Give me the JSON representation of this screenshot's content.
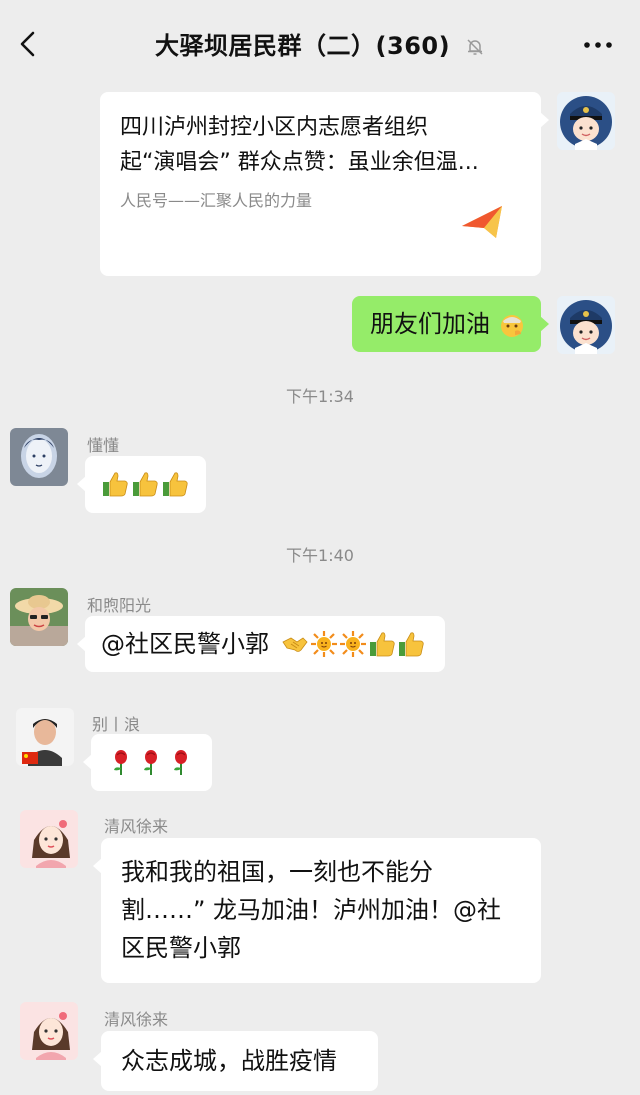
{
  "header": {
    "title": "大驿坝居民群（二）(360)",
    "back_icon": "chevron-left-icon",
    "mute_icon": "bell-off-icon",
    "more_icon": "more-horizontal-icon"
  },
  "messages": [
    {
      "type": "link-card",
      "side": "right",
      "title_line1": "四川泸州封控小区内志愿者组织",
      "title_line2": "起“演唱会” 群众点赞：虽业余但温...",
      "source": "人民号——汇聚人民的力量",
      "icon": "paper-plane-icon"
    },
    {
      "type": "text",
      "side": "right",
      "text": "朋友们加油",
      "emoji": [
        "strong-face-emoji"
      ]
    },
    {
      "type": "time",
      "text": "下午1:34"
    },
    {
      "type": "text",
      "side": "left",
      "sender": "懂懂",
      "text": "",
      "emoji": [
        "thumbs-up-emoji",
        "thumbs-up-emoji",
        "thumbs-up-emoji"
      ]
    },
    {
      "type": "time",
      "text": "下午1:40"
    },
    {
      "type": "text",
      "side": "left",
      "sender": "和煦阳光",
      "text": "@社区民警小郭",
      "emoji": [
        "handshake-emoji",
        "sun-emoji",
        "sun-emoji",
        "thumbs-up-emoji",
        "thumbs-up-emoji"
      ]
    },
    {
      "type": "text",
      "side": "left",
      "sender": "别丨浪",
      "text": "",
      "emoji": [
        "rose-emoji",
        "rose-emoji",
        "rose-emoji"
      ]
    },
    {
      "type": "text",
      "side": "left",
      "sender": "清风徐来",
      "line1": "我和我的祖国，一刻也不能分",
      "line2": "割……” 龙马加油！泸州加油！@社",
      "line3": "区民警小郭"
    },
    {
      "type": "text",
      "side": "left",
      "sender": "清风徐来",
      "text": "众志成城，战胜疫情"
    }
  ],
  "colors": {
    "background": "#ededed",
    "bubble_self": "#95ec69",
    "bubble_other": "#ffffff",
    "meta_text": "#8a8a8a"
  }
}
